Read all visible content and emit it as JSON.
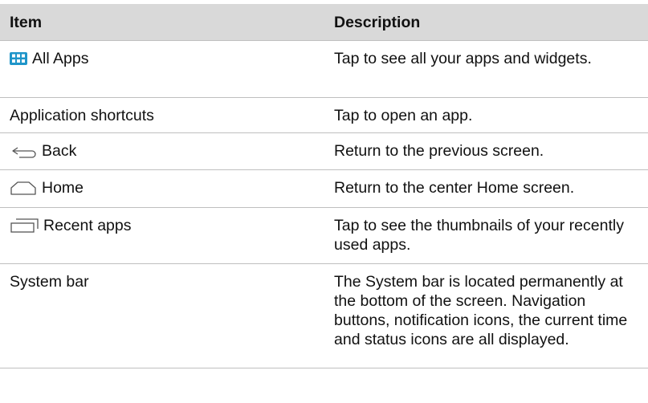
{
  "table": {
    "headers": {
      "item": "Item",
      "description": "Description"
    },
    "rows": [
      {
        "icon": "all-apps-grid-icon",
        "item": "All Apps",
        "description": "Tap to see all your apps and widgets."
      },
      {
        "icon": "",
        "item": "Application shortcuts",
        "description": "Tap to open an app."
      },
      {
        "icon": "back-arrow-icon",
        "item": "Back",
        "description": "Return to the previous screen."
      },
      {
        "icon": "home-icon",
        "item": "Home",
        "description": "Return to the center Home screen."
      },
      {
        "icon": "recent-apps-icon",
        "item": "Recent apps",
        "description": "Tap to see the thumbnails of your recently used apps."
      },
      {
        "icon": "",
        "item": "System bar",
        "description": "The System bar is located permanently at the bottom of the screen. Navigation buttons, notification icons, the current time and status icons are all displayed."
      }
    ]
  },
  "colors": {
    "header_bg": "#d9d9d9",
    "rule": "#bfbfbf",
    "icon_accent": "#1f95c9"
  }
}
